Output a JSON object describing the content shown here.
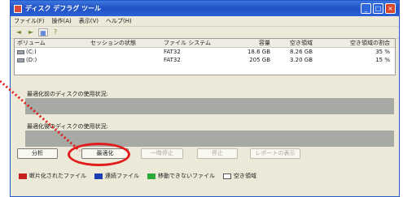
{
  "window": {
    "title": "ディスク デフラグ ツール"
  },
  "menu": [
    "ファイル(F)",
    "操作(A)",
    "表示(V)",
    "ヘルプ(H)"
  ],
  "volumes": {
    "headers": [
      "ボリューム",
      "セッションの状態",
      "ファイル システム",
      "容量",
      "空き領域",
      "空き領域の割合"
    ],
    "rows": [
      [
        "(C:)",
        "",
        "FAT32",
        "18.6 GB",
        "8.26 GB",
        "35 %"
      ],
      [
        "(D:)",
        "",
        "FAT32",
        "205 GB",
        "3.20 GB",
        "15 %"
      ]
    ]
  },
  "sections": {
    "before": "最適化前のディスクの使用状況:",
    "after": "最適化後のディスクの使用状況:"
  },
  "buttons": {
    "analyze": "分析",
    "defragment": "最適化",
    "pause": "一時停止",
    "stop": "停止",
    "report": "レポートの表示"
  },
  "legend": [
    {
      "label": "断片化されたファイル",
      "color": "#c81f1f"
    },
    {
      "label": "連続ファイル",
      "color": "#1c3cb4"
    },
    {
      "label": "移動できないファイル",
      "color": "#2aa83a"
    },
    {
      "label": "空き領域",
      "color": "#ffffff"
    }
  ]
}
